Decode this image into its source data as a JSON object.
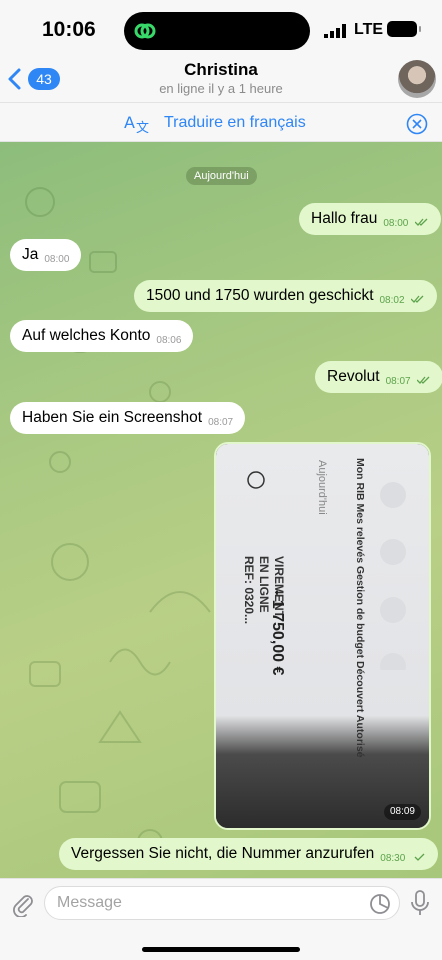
{
  "status_bar": {
    "time": "10:06",
    "network": "LTE"
  },
  "header": {
    "back_count": "43",
    "title": "Christina",
    "subtitle": "en ligne il y a 1 heure"
  },
  "translate_bar": {
    "label": "Traduire en français"
  },
  "chat": {
    "date_label": "Aujourd'hui",
    "messages": [
      {
        "text": "Hallo frau",
        "time": "08:00"
      },
      {
        "text": "Ja",
        "time": "08:00"
      },
      {
        "text": "1500 und 1750 wurden geschickt",
        "time": "08:02"
      },
      {
        "text": "Auf welches Konto",
        "time": "08:06"
      },
      {
        "text": "Revolut",
        "time": "08:07"
      },
      {
        "text": "Haben Sie ein Screenshot",
        "time": "08:07"
      },
      {
        "text": "Vergessen Sie nicht, die Nummer anzurufen",
        "time": "08:30"
      }
    ],
    "photo": {
      "time": "08:09",
      "tabs": "Mon RIB Mes relevés Gestion de budget Découvert Autorisé",
      "date": "Aujourd'hui",
      "line1": "VIREMENT",
      "line2": "EN LIGNE",
      "line3": "REF: 0320...",
      "amount": "- 1 750,00 €"
    }
  },
  "input": {
    "placeholder": "Message"
  },
  "colors": {
    "accent": "#2f86f5",
    "outgoing_bubble": "#e2f7cb",
    "incoming_bubble": "#ffffff"
  },
  "icons": [
    "island-app-icon",
    "back-chevron-icon",
    "translate-icon",
    "close-icon",
    "attachment-icon",
    "sticker-icon",
    "microphone-icon"
  ]
}
